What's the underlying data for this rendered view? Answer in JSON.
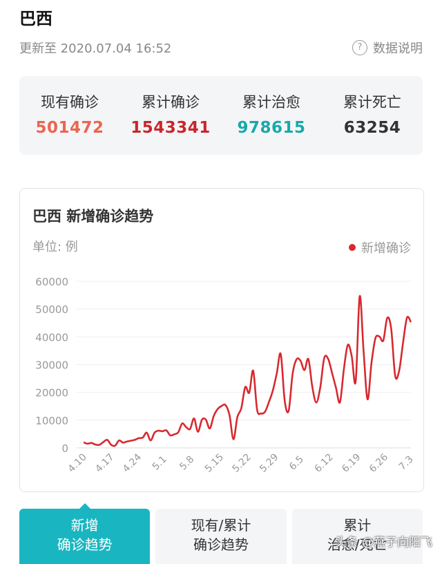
{
  "page": {
    "title": "巴西",
    "updated": "更新至 2020.07.04 16:52",
    "help_label": "数据说明",
    "help_icon": "question-circle-icon"
  },
  "stats": [
    {
      "label": "现有确诊",
      "value": "501472",
      "color": "#e8674f"
    },
    {
      "label": "累计确诊",
      "value": "1543341",
      "color": "#c8262c"
    },
    {
      "label": "累计治愈",
      "value": "978615",
      "color": "#19a9a9"
    },
    {
      "label": "累计死亡",
      "value": "63254",
      "color": "#333333"
    }
  ],
  "card": {
    "title": "巴西 新增确诊趋势",
    "unit": "单位: 例",
    "legend": "新增确诊"
  },
  "chart_data": {
    "type": "line",
    "ylim": [
      0,
      60000
    ],
    "yticks": [
      0,
      10000,
      20000,
      30000,
      40000,
      50000,
      60000
    ],
    "xticks": [
      "4.10",
      "4.17",
      "4.24",
      "5.1",
      "5.8",
      "5.15",
      "5.22",
      "5.29",
      "6.5",
      "6.12",
      "6.19",
      "6.26",
      "7.3"
    ],
    "series": [
      {
        "name": "新增确诊",
        "color": "#d7292f",
        "values": [
          2000,
          1500,
          1800,
          1200,
          1100,
          2100,
          2900,
          1100,
          800,
          2700,
          1900,
          2300,
          2600,
          2900,
          3500,
          3700,
          5500,
          2700,
          5500,
          6200,
          6000,
          6300,
          4500,
          4900,
          5600,
          8800,
          7500,
          6800,
          10600,
          5800,
          10100,
          10200,
          7000,
          11500,
          14000,
          15100,
          15400,
          11800,
          3100,
          11100,
          14300,
          21900,
          19900,
          27800,
          13700,
          12400,
          13000,
          16500,
          20700,
          26900,
          33800,
          16900,
          13400,
          26700,
          31900,
          31400,
          28000,
          32000,
          22000,
          16300,
          21700,
          32300,
          32100,
          27000,
          21600,
          16400,
          28300,
          37100,
          33000,
          23900,
          54600,
          34700,
          17500,
          30600,
          39500,
          40100,
          38700,
          46800,
          43000,
          26000,
          27700,
          37900,
          46900,
          45300
        ]
      }
    ]
  },
  "tabs": [
    {
      "line1": "新增",
      "line2": "确诊趋势",
      "active": true
    },
    {
      "line1": "现有/累计",
      "line2": "确诊趋势",
      "active": false
    },
    {
      "line1": "累计",
      "line2": "治愈/死亡",
      "active": false
    }
  ],
  "watermark": "头条 @燕子向阳飞"
}
